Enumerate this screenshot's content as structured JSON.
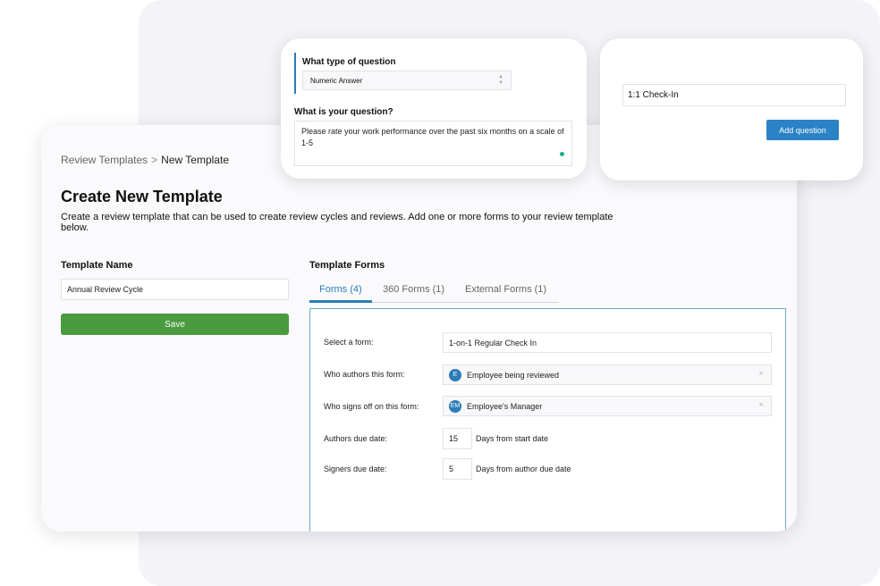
{
  "breadcrumb": {
    "parent": "Review Templates",
    "separator": ">",
    "current": "New Template"
  },
  "page": {
    "title": "Create New Template",
    "description": "Create a review template that can be used to create review cycles and reviews. Add one or more forms to your review template below."
  },
  "template_name": {
    "label": "Template Name",
    "value": "Annual Review Cycle",
    "save_label": "Save"
  },
  "template_forms": {
    "label": "Template Forms",
    "tabs": [
      {
        "label": "Forms (4)",
        "active": true
      },
      {
        "label": "360 Forms (1)",
        "active": false
      },
      {
        "label": "External Forms (1)",
        "active": false
      }
    ],
    "rows": {
      "select_form": {
        "label": "Select a form:",
        "value": "1-on-1 Regular Check In"
      },
      "authors": {
        "label": "Who authors this form:",
        "avatar": "E",
        "value": "Employee being reviewed",
        "clear": "×"
      },
      "signers": {
        "label": "Who signs off on this form:",
        "avatar": "EM",
        "value": "Employee's Manager",
        "clear": "×"
      },
      "authors_due": {
        "label": "Authors due date:",
        "value": "15",
        "suffix": "Days from start date"
      },
      "signers_due": {
        "label": "Signers due date:",
        "value": "5",
        "suffix": "Days from author due date"
      }
    }
  },
  "question_card": {
    "type_label": "What type of question",
    "type_value": "Numeric Answer",
    "question_label": "What is your question?",
    "question_value": "Please rate your work performance over the past six months on a scale of 1-5"
  },
  "checkin_card": {
    "input_value": "1:1 Check-In",
    "button_label": "Add question"
  },
  "colors": {
    "accent": "#2b7cb9",
    "save": "#4a9a3f",
    "button": "#2b83c6"
  }
}
